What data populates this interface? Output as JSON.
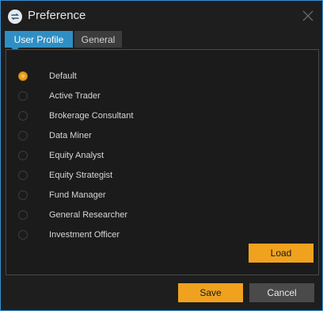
{
  "window": {
    "title": "Preference",
    "logo_icon": "app-logo-icon",
    "close_icon": "close-icon"
  },
  "tabs": [
    {
      "label": "User Profile",
      "active": true
    },
    {
      "label": "General",
      "active": false
    }
  ],
  "profiles": {
    "selected": "Default",
    "items": [
      {
        "label": "Default"
      },
      {
        "label": "Active Trader"
      },
      {
        "label": "Brokerage Consultant"
      },
      {
        "label": "Data Miner"
      },
      {
        "label": "Equity Analyst"
      },
      {
        "label": "Equity Strategist"
      },
      {
        "label": "Fund Manager"
      },
      {
        "label": "General Researcher"
      },
      {
        "label": "Investment Officer"
      }
    ]
  },
  "buttons": {
    "load": "Load",
    "save": "Save",
    "cancel": "Cancel"
  },
  "colors": {
    "accent_blue": "#2f8fc4",
    "accent_orange": "#f0a21e",
    "background": "#1e1e1e"
  }
}
